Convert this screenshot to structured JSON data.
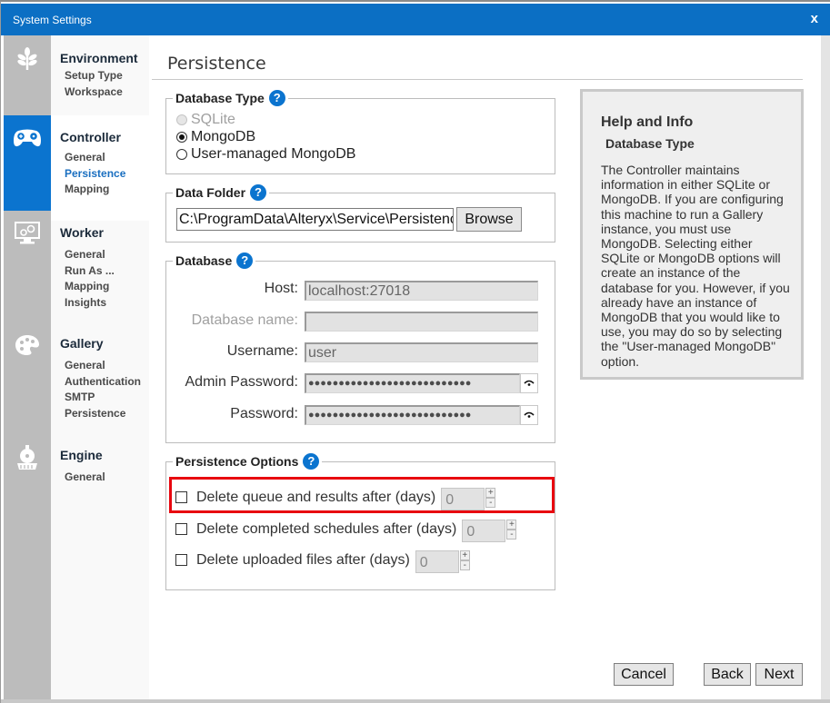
{
  "window": {
    "title": "System Settings",
    "close_label": "x"
  },
  "colors": {
    "titlebar": "#0b6fc4",
    "accent": "#0b74cf",
    "active_nav_text": "#1a6fc0",
    "highlight": "#e8070f"
  },
  "sidebar": {
    "sections": [
      {
        "title": "Environment",
        "icon": "leaf-icon",
        "items": [
          "Setup Type",
          "Workspace"
        ]
      },
      {
        "title": "Controller",
        "icon": "gamepad-icon",
        "active": true,
        "items": [
          "General",
          "Persistence",
          "Mapping"
        ],
        "current_item": "Persistence"
      },
      {
        "title": "Worker",
        "icon": "monitor-gears-icon",
        "items": [
          "General",
          "Run As ...",
          "Mapping",
          "Insights"
        ]
      },
      {
        "title": "Gallery",
        "icon": "palette-icon",
        "items": [
          "General",
          "Authentication",
          "SMTP",
          "Persistence"
        ]
      },
      {
        "title": "Engine",
        "icon": "locomotive-icon",
        "items": [
          "General"
        ]
      }
    ]
  },
  "main": {
    "page_title": "Persistence",
    "database_type": {
      "legend": "Database Type",
      "help": "?",
      "options": [
        {
          "label": "SQLite",
          "selected": false,
          "disabled": true
        },
        {
          "label": "MongoDB",
          "selected": true,
          "disabled": false
        },
        {
          "label": "User-managed MongoDB",
          "selected": false,
          "disabled": false
        }
      ]
    },
    "data_folder": {
      "legend": "Data Folder",
      "help": "?",
      "value": "C:\\ProgramData\\Alteryx\\Service\\Persistence",
      "browse_label": "Browse"
    },
    "database": {
      "legend": "Database",
      "help": "?",
      "fields": [
        {
          "label": "Host:",
          "value": "localhost:27018",
          "disabled": false
        },
        {
          "label": "Database name:",
          "value": "",
          "disabled": true
        },
        {
          "label": "Username:",
          "value": "user",
          "disabled": false
        },
        {
          "label": "Admin Password:",
          "value": "●●●●●●●●●●●●●●●●●●●●●●●●●●●",
          "password": true
        },
        {
          "label": "Password:",
          "value": "●●●●●●●●●●●●●●●●●●●●●●●●●●●",
          "password": true
        }
      ]
    },
    "persistence_options": {
      "legend": "Persistence Options",
      "help": "?",
      "options": [
        {
          "label": "Delete queue and results after (days)",
          "checked": false,
          "value": "0",
          "highlighted": true
        },
        {
          "label": "Delete completed schedules after (days)",
          "checked": false,
          "value": "0"
        },
        {
          "label": "Delete uploaded files after (days)",
          "checked": false,
          "value": "0"
        }
      ],
      "spin_up": "+",
      "spin_down": "-"
    },
    "help_panel": {
      "title": "Help and Info",
      "subtitle": "Database Type",
      "body": "The Controller maintains information in either SQLite or MongoDB. If you are configuring this machine to run a Gallery instance, you must use MongoDB. Selecting either SQLite or MongoDB options will create an instance of the database for you. However, if you already have an instance of MongoDB that you would like to use, you may do so by selecting the \"User-managed MongoDB\" option."
    }
  },
  "footer": {
    "cancel_label": "Cancel",
    "back_label": "Back",
    "next_label": "Next"
  }
}
